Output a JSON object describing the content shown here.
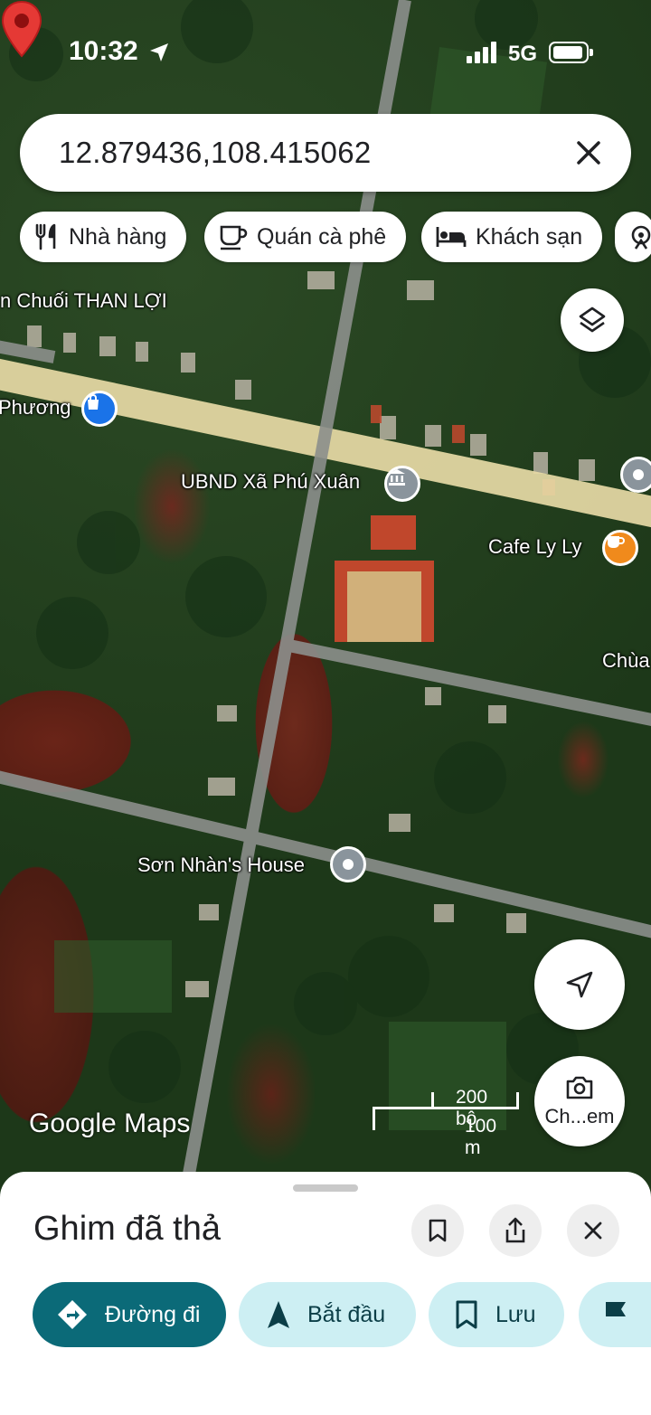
{
  "status_bar": {
    "time": "10:32",
    "network": "5G"
  },
  "search": {
    "query": "12.879436,108.415062"
  },
  "chips": [
    {
      "label": "Nhà hàng",
      "icon": "restaurant-icon"
    },
    {
      "label": "Quán cà phê",
      "icon": "coffee-icon"
    },
    {
      "label": "Khách sạn",
      "icon": "hotel-icon"
    }
  ],
  "map": {
    "labels": {
      "shop": "n Chuối THAN LỢI",
      "phuong": "Phương",
      "ubnd": "UBND Xã Phú Xuân",
      "cafe": "Cafe Ly Ly",
      "chua": "Chùa",
      "house": "Sơn Nhàn's House"
    },
    "brand": "Google Maps",
    "scale_imperial": "200 bộ",
    "scale_metric": "100 m",
    "camera_label": "Ch...em"
  },
  "sheet": {
    "title": "Ghim đã thả",
    "actions": [
      {
        "label": "Đường đi",
        "icon": "directions-icon"
      },
      {
        "label": "Bắt đầu",
        "icon": "navigation-start-icon"
      },
      {
        "label": "Lưu",
        "icon": "bookmark-icon"
      }
    ]
  },
  "colors": {
    "primary": "#0b6a78",
    "secondary": "#cdeff3",
    "pin": "#e53935",
    "poi_blue": "#1a73e8",
    "poi_orange": "#f08a1c"
  }
}
